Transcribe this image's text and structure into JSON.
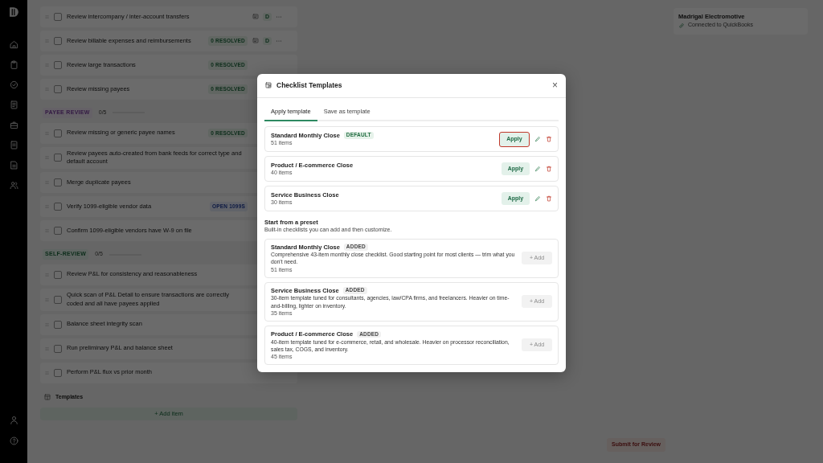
{
  "checklist": {
    "groups": [
      {
        "items": [
          {
            "text": "Review intercompany / inter-account transfers",
            "checked": false,
            "actions": true,
            "assignee": "D"
          },
          {
            "text": "Review billable expenses and reimbursements",
            "checked": false,
            "badge": {
              "kind": "resolved",
              "text": "0 RESOLVED"
            },
            "actions": true,
            "assignee": "D"
          },
          {
            "text": "Review large transactions",
            "checked": false,
            "badge": {
              "kind": "resolved",
              "text": "0 RESOLVED"
            },
            "actions": false
          },
          {
            "text": "Review missing payees",
            "checked": false,
            "badge": {
              "kind": "resolved",
              "text": "0 RESOLVED"
            },
            "actions": false
          }
        ]
      },
      {
        "header": {
          "label": "PAYEE REVIEW",
          "kind": "payee",
          "count": "0/5",
          "level": 0
        },
        "items": [
          {
            "text": "Review missing or generic payee names",
            "checked": false,
            "badge": {
              "kind": "resolved",
              "text": "0 RESOLVED"
            },
            "actions": false
          },
          {
            "text": "Review payees auto-created from bank feeds for correct type and default account",
            "checked": false,
            "actions": false
          },
          {
            "text": "Merge duplicate payees",
            "checked": false,
            "actions": false
          },
          {
            "text": "Verify 1099-eligible vendor data",
            "checked": false,
            "badge": {
              "kind": "open",
              "text": "OPEN 1099S"
            },
            "actions": false
          },
          {
            "text": "Confirm 1099-eligible vendors have W-9 on file",
            "checked": false,
            "actions": false
          }
        ]
      },
      {
        "header": {
          "label": "SELF-REVIEW",
          "kind": "self",
          "count": "0/5",
          "level": 0
        },
        "items": [
          {
            "text": "Review P&L for consistency and reasonableness",
            "checked": false,
            "actions": false
          },
          {
            "text": "Quick scan of P&L Detail to ensure transactions are correctly coded and all have payees applied",
            "checked": false,
            "actions": false
          },
          {
            "text": "Balance sheet integrity scan",
            "checked": false,
            "actions": false
          },
          {
            "text": "Run preliminary P&L and balance sheet",
            "checked": false,
            "actions": false
          },
          {
            "text": "Perform P&L flux vs prior month",
            "checked": false,
            "actions": false
          }
        ]
      }
    ],
    "templates_link": "Templates",
    "add_item": "+ Add item"
  },
  "client": {
    "name": "Madrigal Electromotive",
    "status": "Connected to QuickBooks"
  },
  "submit_button": "Submit for Review",
  "modal": {
    "title": "Checklist Templates",
    "close": "×",
    "tabs": [
      {
        "label": "Apply template",
        "selected": true
      },
      {
        "label": "Save as template",
        "selected": false
      }
    ],
    "templates": [
      {
        "name": "Standard Monthly Close",
        "badge": "DEFAULT",
        "count": "51 items",
        "button": "Apply",
        "focused": true
      },
      {
        "name": "Product / E-commerce Close",
        "count": "40 items",
        "button": "Apply",
        "focused": false
      },
      {
        "name": "Service Business Close",
        "count": "30 items",
        "button": "Apply",
        "focused": false
      }
    ],
    "preset_title": "Start from a preset",
    "preset_subtitle": "Built-in checklists you can add and then customize.",
    "presets": [
      {
        "name": "Standard Monthly Close",
        "badge": "ADDED",
        "description": "Comprehensive 43-item monthly close checklist. Good starting point for most clients — trim what you don't need.",
        "count": "51 items",
        "button": "+ Add",
        "disabled": true
      },
      {
        "name": "Service Business Close",
        "badge": "ADDED",
        "description": "30-item template tuned for consultants, agencies, law/CPA firms, and freelancers. Heavier on time-and-billing, lighter on inventory.",
        "count": "35 items",
        "button": "+ Add",
        "disabled": true
      },
      {
        "name": "Product / E-commerce Close",
        "badge": "ADDED",
        "description": "40-item template tuned for e-commerce, retail, and wholesale. Heavier on processor reconciliation, sales tax, COGS, and inventory.",
        "count": "45 items",
        "button": "+ Add",
        "disabled": true
      }
    ]
  }
}
